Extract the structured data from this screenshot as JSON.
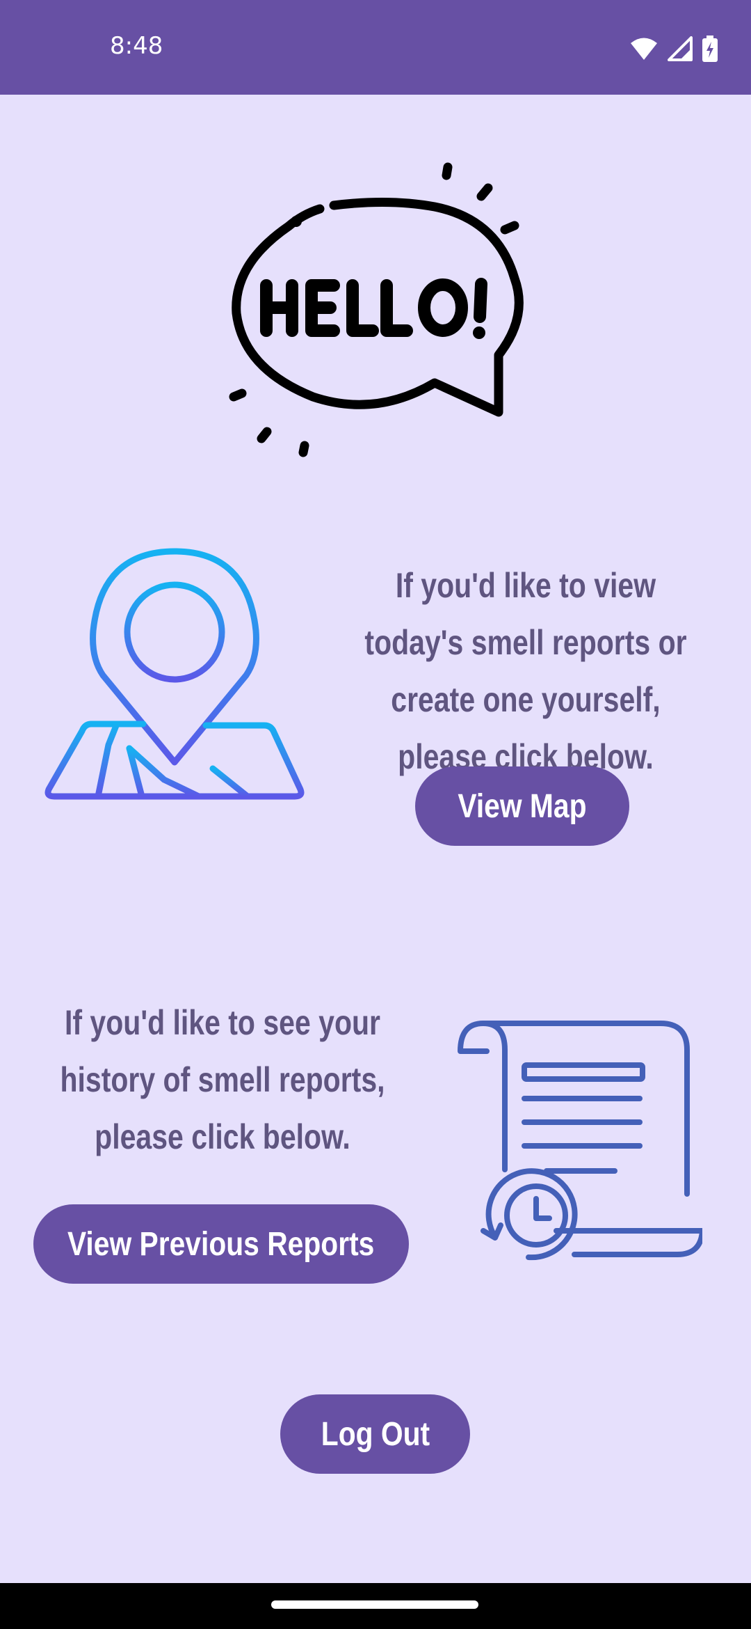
{
  "status_bar": {
    "time": "8:48",
    "icons": [
      "wifi-icon",
      "cellular-signal-icon",
      "battery-charging-icon"
    ],
    "background": "#6750A4"
  },
  "hello_graphic": {
    "icon": "hello-speech-bubble-icon",
    "lettering": "HELLO!"
  },
  "map_section": {
    "icon": "map-pin-icon",
    "text": "If you'd like to view today's smell reports or create one yourself, please click below.",
    "button_label": "View Map"
  },
  "history_section": {
    "icon": "report-history-icon",
    "text": "If you'd like to see your history of smell reports, please click below.",
    "button_label": "View Previous Reports"
  },
  "logout": {
    "button_label": "Log Out"
  },
  "colors": {
    "background": "#E6E0FC",
    "accent": "#6750A4",
    "body_text": "#5F5580",
    "map_icon_gradient": [
      "#16B2F2",
      "#5B58E8"
    ],
    "report_icon": "#4460B8"
  }
}
